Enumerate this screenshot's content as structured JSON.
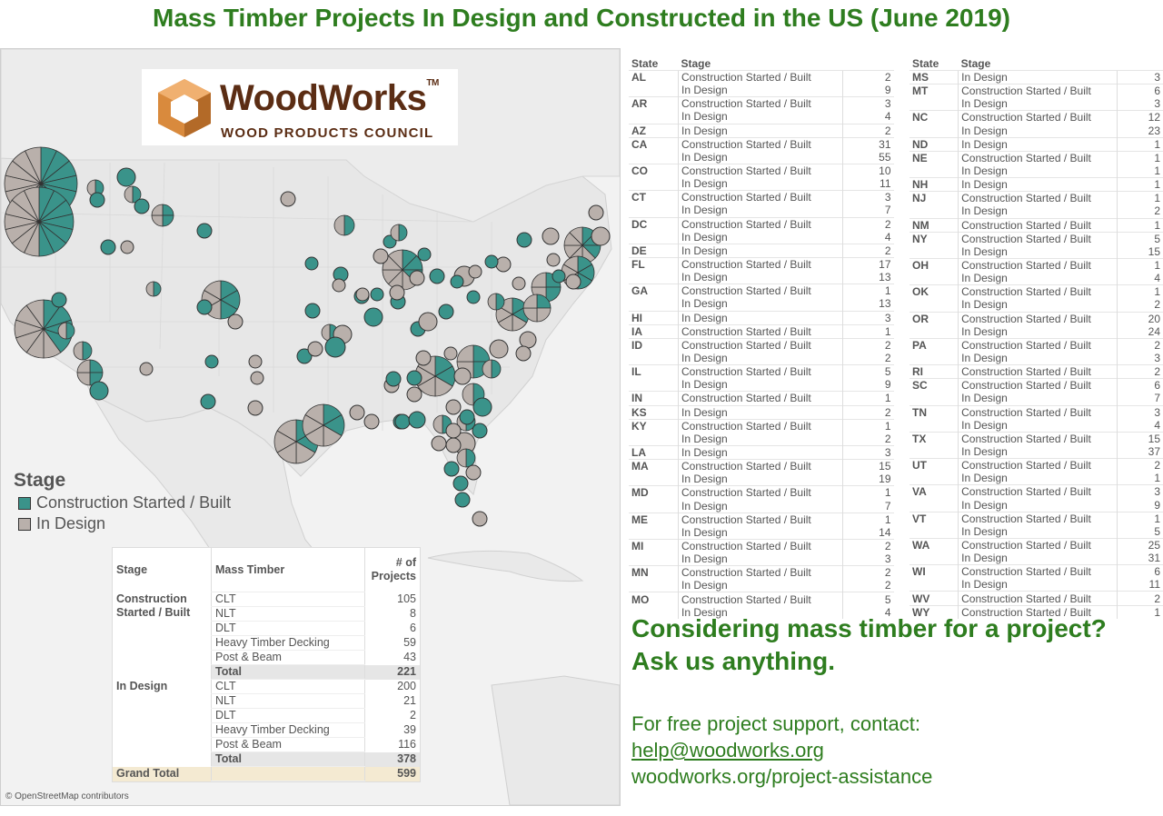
{
  "title": "Mass Timber Projects In Design and Constructed in the US (June 2019)",
  "colors": {
    "built": "#3a938a",
    "design": "#b9b0ab",
    "accent": "#2e7d1f",
    "brand": "#5b2d14"
  },
  "logo": {
    "name": "WoodWorks",
    "tm": "TM",
    "subtitle": "WOOD PRODUCTS COUNCIL"
  },
  "legend": {
    "title": "Stage",
    "items": [
      "Construction Started / Built",
      "In Design"
    ]
  },
  "attribution": "© OpenStreetMap contributors",
  "summary": {
    "headers": [
      "Stage",
      "Mass Timber",
      "# of Projects"
    ],
    "groups": [
      {
        "stage": "Construction Started / Built",
        "rows": [
          [
            "CLT",
            "105"
          ],
          [
            "NLT",
            "8"
          ],
          [
            "DLT",
            "6"
          ],
          [
            "Heavy Timber Decking",
            "59"
          ],
          [
            "Post & Beam",
            "43"
          ]
        ],
        "total_label": "Total",
        "total": "221"
      },
      {
        "stage": "In Design",
        "rows": [
          [
            "CLT",
            "200"
          ],
          [
            "NLT",
            "21"
          ],
          [
            "DLT",
            "2"
          ],
          [
            "Heavy Timber Decking",
            "39"
          ],
          [
            "Post & Beam",
            "116"
          ]
        ],
        "total_label": "Total",
        "total": "378"
      }
    ],
    "grand_total_label": "Grand Total",
    "grand_total": "599"
  },
  "state_table": {
    "headers": [
      "State",
      "Stage"
    ],
    "left": [
      [
        "AL",
        "Construction Started / Built",
        "2"
      ],
      [
        "",
        "In Design",
        "9"
      ],
      [
        "AR",
        "Construction Started / Built",
        "3"
      ],
      [
        "",
        "In Design",
        "4"
      ],
      [
        "AZ",
        "In Design",
        "2"
      ],
      [
        "CA",
        "Construction Started / Built",
        "31"
      ],
      [
        "",
        "In Design",
        "55"
      ],
      [
        "CO",
        "Construction Started / Built",
        "10"
      ],
      [
        "",
        "In Design",
        "11"
      ],
      [
        "CT",
        "Construction Started / Built",
        "3"
      ],
      [
        "",
        "In Design",
        "7"
      ],
      [
        "DC",
        "Construction Started / Built",
        "2"
      ],
      [
        "",
        "In Design",
        "4"
      ],
      [
        "DE",
        "In Design",
        "2"
      ],
      [
        "FL",
        "Construction Started / Built",
        "17"
      ],
      [
        "",
        "In Design",
        "13"
      ],
      [
        "GA",
        "Construction Started / Built",
        "1"
      ],
      [
        "",
        "In Design",
        "13"
      ],
      [
        "HI",
        "In Design",
        "3"
      ],
      [
        "IA",
        "Construction Started / Built",
        "1"
      ],
      [
        "ID",
        "Construction Started / Built",
        "2"
      ],
      [
        "",
        "In Design",
        "2"
      ],
      [
        "IL",
        "Construction Started / Built",
        "5"
      ],
      [
        "",
        "In Design",
        "9"
      ],
      [
        "IN",
        "Construction Started / Built",
        "1"
      ],
      [
        "KS",
        "In Design",
        "2"
      ],
      [
        "KY",
        "Construction Started / Built",
        "1"
      ],
      [
        "",
        "In Design",
        "2"
      ],
      [
        "LA",
        "In Design",
        "3"
      ],
      [
        "MA",
        "Construction Started / Built",
        "15"
      ],
      [
        "",
        "In Design",
        "19"
      ],
      [
        "MD",
        "Construction Started / Built",
        "1"
      ],
      [
        "",
        "In Design",
        "7"
      ],
      [
        "ME",
        "Construction Started / Built",
        "1"
      ],
      [
        "",
        "In Design",
        "14"
      ],
      [
        "MI",
        "Construction Started / Built",
        "2"
      ],
      [
        "",
        "In Design",
        "3"
      ],
      [
        "MN",
        "Construction Started / Built",
        "2"
      ],
      [
        "",
        "In Design",
        "2"
      ],
      [
        "MO",
        "Construction Started / Built",
        "5"
      ],
      [
        "",
        "In Design",
        "4"
      ]
    ],
    "right": [
      [
        "MS",
        "In Design",
        "3"
      ],
      [
        "MT",
        "Construction Started / Built",
        "6"
      ],
      [
        "",
        "In Design",
        "3"
      ],
      [
        "NC",
        "Construction Started / Built",
        "12"
      ],
      [
        "",
        "In Design",
        "23"
      ],
      [
        "ND",
        "In Design",
        "1"
      ],
      [
        "NE",
        "Construction Started / Built",
        "1"
      ],
      [
        "",
        "In Design",
        "1"
      ],
      [
        "NH",
        "In Design",
        "1"
      ],
      [
        "NJ",
        "Construction Started / Built",
        "1"
      ],
      [
        "",
        "In Design",
        "2"
      ],
      [
        "NM",
        "Construction Started / Built",
        "1"
      ],
      [
        "NY",
        "Construction Started / Built",
        "5"
      ],
      [
        "",
        "In Design",
        "15"
      ],
      [
        "OH",
        "Construction Started / Built",
        "1"
      ],
      [
        "",
        "In Design",
        "4"
      ],
      [
        "OK",
        "Construction Started / Built",
        "1"
      ],
      [
        "",
        "In Design",
        "2"
      ],
      [
        "OR",
        "Construction Started / Built",
        "20"
      ],
      [
        "",
        "In Design",
        "24"
      ],
      [
        "PA",
        "Construction Started / Built",
        "2"
      ],
      [
        "",
        "In Design",
        "3"
      ],
      [
        "RI",
        "Construction Started / Built",
        "2"
      ],
      [
        "SC",
        "Construction Started / Built",
        "6"
      ],
      [
        "",
        "In Design",
        "7"
      ],
      [
        "TN",
        "Construction Started / Built",
        "3"
      ],
      [
        "",
        "In Design",
        "4"
      ],
      [
        "TX",
        "Construction Started / Built",
        "15"
      ],
      [
        "",
        "In Design",
        "37"
      ],
      [
        "UT",
        "Construction Started / Built",
        "2"
      ],
      [
        "",
        "In Design",
        "1"
      ],
      [
        "VA",
        "Construction Started / Built",
        "3"
      ],
      [
        "",
        "In Design",
        "9"
      ],
      [
        "VT",
        "Construction Started / Built",
        "1"
      ],
      [
        "",
        "In Design",
        "5"
      ],
      [
        "WA",
        "Construction Started / Built",
        "25"
      ],
      [
        "",
        "In Design",
        "31"
      ],
      [
        "WI",
        "Construction Started / Built",
        "6"
      ],
      [
        "",
        "In Design",
        "11"
      ],
      [
        "WV",
        "Construction Started / Built",
        "2"
      ],
      [
        "WY",
        "Construction Started / Built",
        "1"
      ]
    ]
  },
  "promo": {
    "headline1": "Considering mass timber for a project?",
    "headline2": "Ask us anything.",
    "line": "For free project support, contact:",
    "email": "help@woodworks.org",
    "url": "woodworks.org/project-assistance"
  }
}
